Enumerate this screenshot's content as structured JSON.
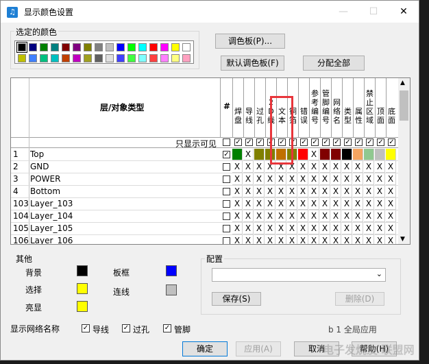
{
  "window": {
    "title": "显示颜色设置"
  },
  "palette_group": {
    "label": "选定的颜色"
  },
  "buttons": {
    "palette": "调色板(P)...",
    "default_palette": "默认调色板(F)",
    "assign_all": "分配全部",
    "save": "保存(S)",
    "delete": "删除(D)",
    "ok": "确定",
    "apply": "应用(A)",
    "cancel": "取消",
    "help": "帮助(H)"
  },
  "table": {
    "header_type": "层/对象类型",
    "header_hash": "#",
    "visible_only": "只显示可见",
    "columns": [
      "焊盘",
      "导线",
      "过孔",
      "2D线",
      "文本",
      "铜箔",
      "错误",
      "参考编号",
      "管脚编号",
      "网络名",
      "类型",
      "属性",
      "禁止区域",
      "顶面",
      "底面"
    ],
    "rows": [
      {
        "num": "1",
        "name": "Top"
      },
      {
        "num": "2",
        "name": "GND"
      },
      {
        "num": "3",
        "name": "POWER"
      },
      {
        "num": "4",
        "name": "Bottom"
      },
      {
        "num": "103",
        "name": "Layer_103"
      },
      {
        "num": "104",
        "name": "Layer_104"
      },
      {
        "num": "105",
        "name": "Layer_105"
      },
      {
        "num": "106",
        "name": "Layer_106"
      }
    ],
    "cell_x": "X",
    "check_mark": "✓",
    "top_row_colors": [
      "#008000",
      "#ffffff",
      "#808000",
      "#808000",
      "#c07000",
      "#808000",
      "#ff0000",
      "#ffffff",
      "#800000",
      "#800000",
      "#000000",
      "#f4a460",
      "#90c890",
      "#c0c0c0",
      "#ffff00"
    ]
  },
  "other": {
    "label": "其他",
    "background": "背景",
    "board_frame": "板框",
    "select": "选择",
    "connection": "连线",
    "highlight": "亮显",
    "colors": {
      "background": "#000000",
      "board_frame": "#0000ff",
      "select": "#ffff00",
      "connection": "#c0c0c0",
      "highlight": "#ffff00"
    }
  },
  "config": {
    "label": "配置"
  },
  "net_names": {
    "label": "显示网络名称",
    "trace": "导线",
    "via": "过孔",
    "pin": "管脚"
  },
  "watermark": "电子发烧友 联盟网",
  "partial_text": "b 1 全局应用"
}
